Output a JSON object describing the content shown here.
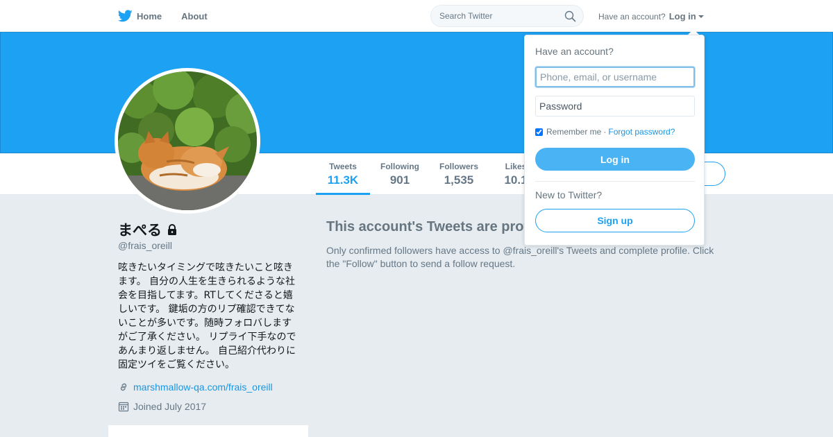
{
  "nav": {
    "home_label": "Home",
    "about_label": "About",
    "search_placeholder": "Search Twitter",
    "have_account": "Have an account?",
    "login_label": "Log in"
  },
  "profile": {
    "display_name": "まぺる",
    "handle": "@frais_oreill",
    "bio": "呟きたいタイミングで呟きたいこと呟きます。 自分の人生を生きられるような社会を目指してます。RTしてくださると嬉しいです。 鍵垢の方のリプ確認できてないことが多いです。随時フォロバしますがご了承ください。 リプライ下手なのであんまり返しません。 自己紹介代わりに固定ツイをご覧ください。",
    "website": "marshmallow-qa.com/frais_oreill",
    "joined": "Joined July 2017",
    "protected": true
  },
  "stats": [
    {
      "label": "Tweets",
      "value": "11.3K",
      "active": true
    },
    {
      "label": "Following",
      "value": "901",
      "active": false
    },
    {
      "label": "Followers",
      "value": "1,535",
      "active": false
    },
    {
      "label": "Likes",
      "value": "10.1",
      "active": false
    }
  ],
  "protected_notice": {
    "title": "This account's Tweets are protected.",
    "body": "Only confirmed followers have access to @frais_oreill's Tweets and complete profile. Click the \"Follow\" button to send a follow request."
  },
  "login_dropdown": {
    "question": "Have an account?",
    "username_placeholder": "Phone, email, or username",
    "password_placeholder": "Password",
    "remember_label": "Remember me",
    "separator": "·",
    "forgot_label": "Forgot password?",
    "remember_checked": true,
    "login_button": "Log in",
    "new_question": "New to Twitter?",
    "signup_button": "Sign up"
  },
  "colors": {
    "brand": "#1da1f2",
    "header": "#1da1f2",
    "background": "#e6ecf0",
    "link": "#1b95e0"
  },
  "icons": {
    "logo": "twitter-bird-icon",
    "search": "search-icon",
    "lock": "lock-icon",
    "link": "link-icon",
    "calendar": "calendar-icon"
  }
}
